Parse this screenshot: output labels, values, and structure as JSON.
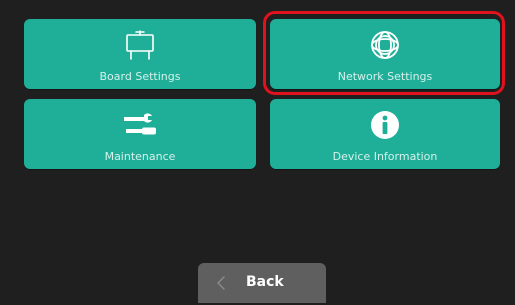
{
  "tiles": {
    "board": {
      "label": "Board Settings",
      "icon": "whiteboard-icon"
    },
    "network": {
      "label": "Network Settings",
      "icon": "globe-icon",
      "selected": true
    },
    "maintenance": {
      "label": "Maintenance",
      "icon": "tools-icon"
    },
    "device": {
      "label": "Device Information",
      "icon": "info-icon"
    }
  },
  "footer": {
    "back_label": "Back",
    "back_icon": "chevron-left-icon"
  },
  "colors": {
    "background": "#1f1f1f",
    "tile": "#1fae98",
    "tile_label": "#d5f1eb",
    "selection": "#e0121d",
    "back_button": "#5f5f5f"
  }
}
